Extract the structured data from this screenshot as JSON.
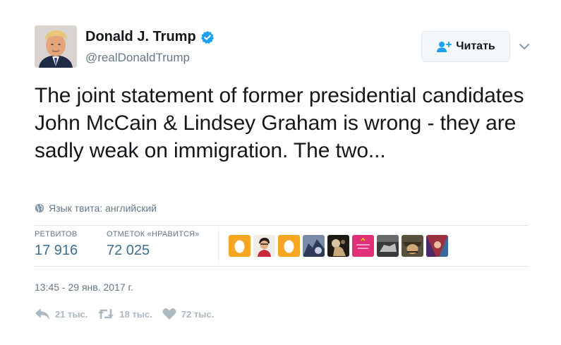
{
  "author": {
    "display_name": "Donald J. Trump",
    "handle": "@realDonaldTrump",
    "verified": true
  },
  "follow_button": {
    "label": "Читать",
    "icon": "add-user-icon"
  },
  "tweet": {
    "text": "The joint statement of former presidential candidates John McCain & Lindsey Graham is wrong - they are sadly weak on immigration. The two...",
    "language_note": "Язык твита: английский"
  },
  "stats": {
    "retweets_label": "РЕТВИТОВ",
    "retweets_value": "17 916",
    "likes_label": "ОТМЕТОК «НРАВИТСЯ»",
    "likes_value": "72 025"
  },
  "likers": [
    {
      "name": "egg-avatar-1",
      "bg": "#f5a623"
    },
    {
      "name": "avatar-2",
      "bg": "#f0ece8"
    },
    {
      "name": "egg-avatar-3",
      "bg": "#f5a623"
    },
    {
      "name": "avatar-4",
      "bg": "#3a4a6a"
    },
    {
      "name": "avatar-5",
      "bg": "#2a2420"
    },
    {
      "name": "avatar-6",
      "bg": "#e0307a"
    },
    {
      "name": "avatar-7",
      "bg": "#333333"
    },
    {
      "name": "avatar-8",
      "bg": "#5a5040"
    },
    {
      "name": "avatar-9",
      "bg": "#9a3040"
    }
  ],
  "timestamp": "13:45 - 29 янв. 2017 г.",
  "actions": {
    "reply_count": "21 тыс.",
    "retweet_count": "18 тыс.",
    "like_count": "72 тыс."
  },
  "colors": {
    "text": "#14171a",
    "secondary": "#657786",
    "stat_value": "#3b6e8f",
    "verified": "#1da1f2",
    "action_gray": "#aab8c2",
    "divider": "#e1e8ed"
  }
}
